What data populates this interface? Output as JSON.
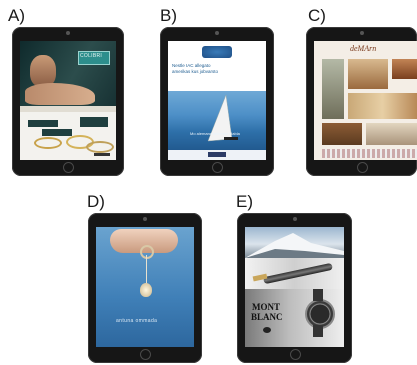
{
  "panels": [
    {
      "label": "A)",
      "ad": {
        "brand": "COLIBRI"
      }
    },
    {
      "label": "B)",
      "ad": {
        "headline": "Nestle IAC allegato\namerikas kus jobvarsto",
        "tagline": "Mo alemana inlinmuo blabla"
      }
    },
    {
      "label": "C)",
      "ad": {
        "brand": "deMArn"
      }
    },
    {
      "label": "D)",
      "ad": {
        "tagline": "antuna ommada"
      }
    },
    {
      "label": "E)",
      "ad": {
        "brand_line1": "MONT",
        "brand_line2": "BLANC"
      }
    }
  ]
}
